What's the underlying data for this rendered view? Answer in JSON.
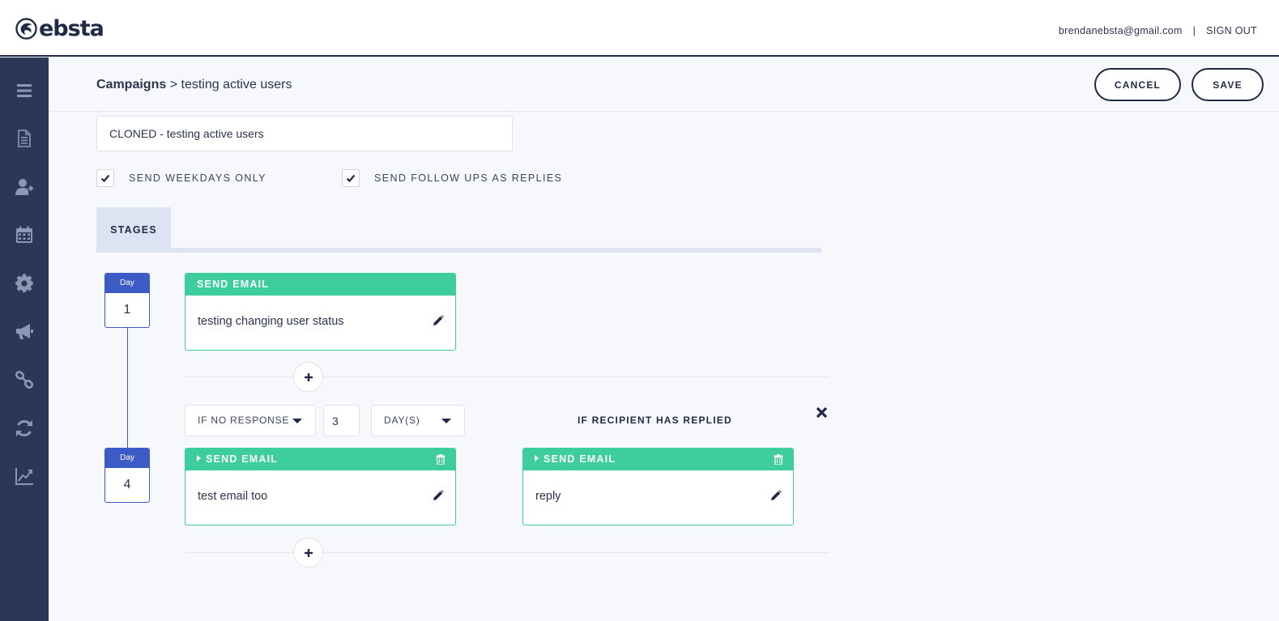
{
  "app": {
    "brand": "ebsta"
  },
  "user": {
    "email": "brendanebsta@gmail.com",
    "separator": "|",
    "sign_out": "SIGN OUT"
  },
  "sidebar": {
    "items": [
      {
        "icon": "menu-icon"
      },
      {
        "icon": "document-icon"
      },
      {
        "icon": "add-user-icon"
      },
      {
        "icon": "calendar-icon"
      },
      {
        "icon": "gear-icon"
      },
      {
        "icon": "megaphone-icon"
      },
      {
        "icon": "link-icon"
      },
      {
        "icon": "refresh-icon"
      },
      {
        "icon": "chart-icon"
      }
    ]
  },
  "breadcrumb": {
    "root": "Campaigns",
    "separator": ">",
    "current": "testing active users"
  },
  "actions": {
    "cancel": "CANCEL",
    "save": "SAVE"
  },
  "campaign": {
    "name": "CLONED - testing active users"
  },
  "options": {
    "weekdays_only": {
      "label": "SEND WEEKDAYS ONLY",
      "checked": true
    },
    "followups_as_replies": {
      "label": "SEND FOLLOW UPS AS REPLIES",
      "checked": true
    }
  },
  "tabs": {
    "stages": "STAGES"
  },
  "stages": [
    {
      "day_label": "Day",
      "day": "1",
      "card": {
        "title": "SEND EMAIL",
        "body": "testing changing user status"
      }
    },
    {
      "day_label": "Day",
      "day": "4",
      "condition": {
        "trigger": "IF NO RESPONSE",
        "amount": "3",
        "unit": "DAY(S)"
      },
      "card": {
        "title": "SEND EMAIL",
        "body": "test email too"
      },
      "replied_branch": {
        "label": "IF RECIPIENT HAS REPLIED",
        "card": {
          "title": "SEND EMAIL",
          "body": "reply"
        }
      }
    }
  ],
  "colors": {
    "sidebar": "#2c3757",
    "accent_green": "#3ecd9d",
    "day_blue": "#3d5bc7",
    "navy": "#1f2a44"
  }
}
